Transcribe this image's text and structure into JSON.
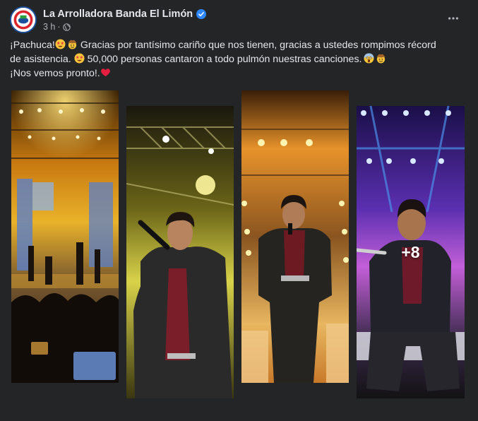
{
  "post": {
    "author": "La Arrolladora Banda El Limón",
    "verified": true,
    "time": "3 h",
    "separator": "·",
    "audience_icon": "globe-icon",
    "more_icon": "ellipsis-icon",
    "caption": {
      "line1_a": "¡Pachuca!",
      "line1_b": " Gracias por tantísimo cariño que nos tienen, gracias a ustedes rompimos récord",
      "line2_a": "de asistencia. ",
      "line2_b": " 50,000 personas cantaron a todo pulmón nuestras canciones.",
      "line3": "¡Nos vemos pronto!."
    },
    "emojis": {
      "star_struck": "star-struck-emoji",
      "cowboy": "cowboy-emoji",
      "screaming": "screaming-face-emoji",
      "heart": "red-heart-emoji"
    },
    "photos": [
      {
        "subject": "concert-stage-crowd-photo"
      },
      {
        "subject": "singer-with-microphone-photo"
      },
      {
        "subject": "singer-on-stage-photo"
      },
      {
        "subject": "performer-kneeling-photo"
      }
    ],
    "more_photos_label": "+8"
  },
  "colors": {
    "background": "#242526",
    "text": "#e4e6eb",
    "secondary_text": "#b0b3b8",
    "verified_blue": "#2d88ff",
    "heart_red": "#e41e3f"
  }
}
